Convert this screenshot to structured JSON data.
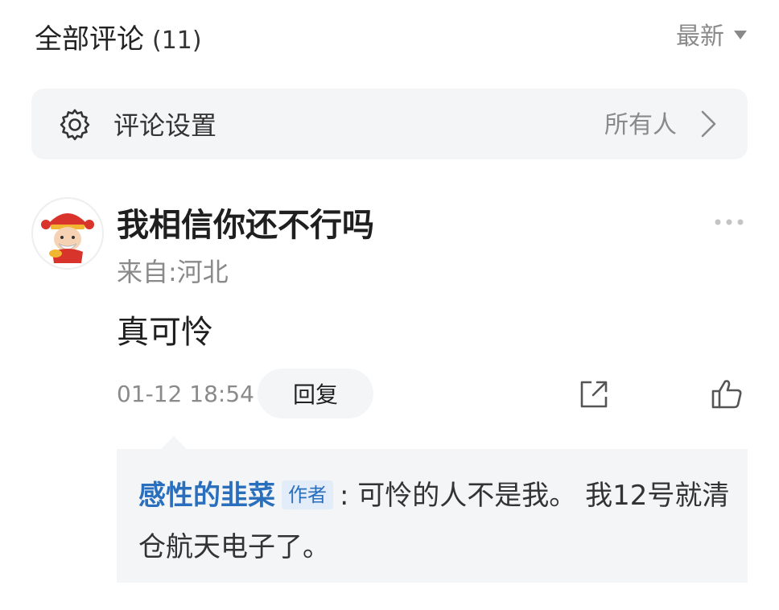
{
  "header": {
    "title": "全部评论",
    "count": "(11)",
    "sort_label": "最新"
  },
  "settings": {
    "label": "评论设置",
    "value": "所有人"
  },
  "comment": {
    "username": "我相信你还不行吗",
    "location": "来自:河北",
    "content": "真可怜",
    "time": "01-12 18:54",
    "reply_button": "回复"
  },
  "reply": {
    "author": "感性的韭菜",
    "badge": "作者",
    "text": ": 可怜的人不是我。 我12号就清仓航天电子了。"
  },
  "colors": {
    "accent": "#2a6fbd",
    "panel_bg": "#f4f5f7",
    "muted_text": "#8a8a8a"
  }
}
